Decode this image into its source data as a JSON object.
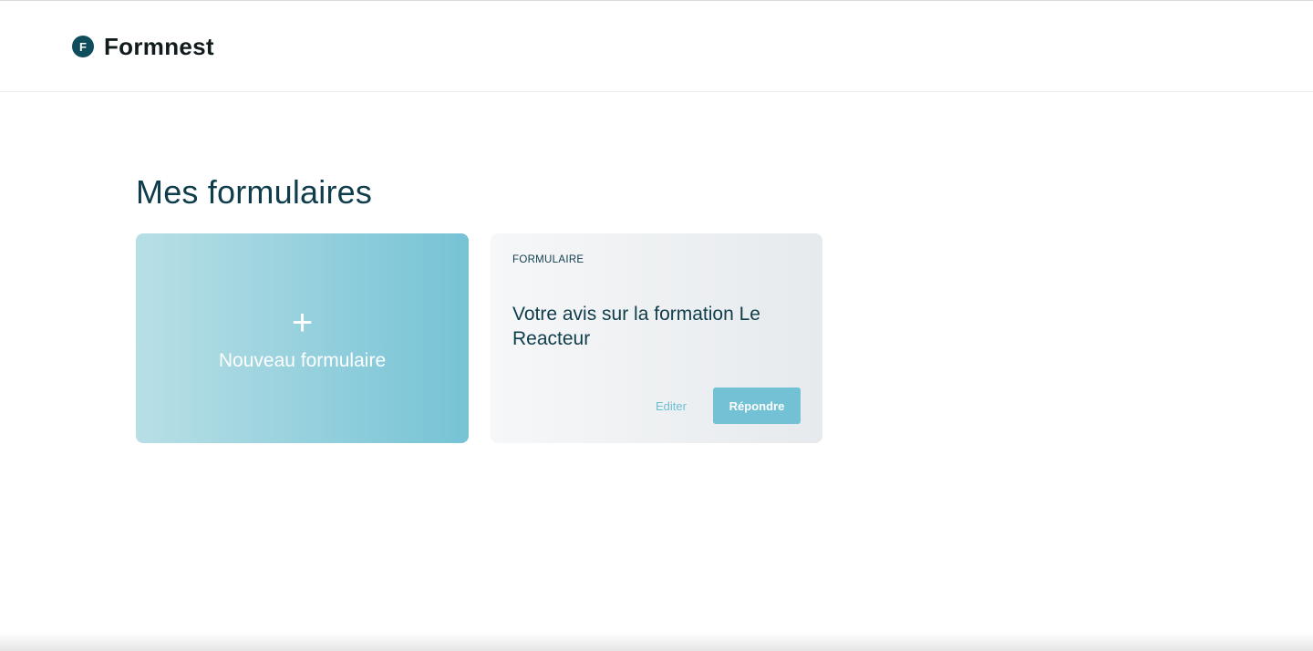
{
  "app": {
    "brand_initial": "F",
    "brand_name": "Formnest"
  },
  "main": {
    "page_title": "Mes formulaires",
    "new_card": {
      "plus_symbol": "+",
      "label": "Nouveau formulaire"
    },
    "forms": [
      {
        "kind": "FORMULAIRE",
        "title": "Votre avis sur la formation Le Reacteur",
        "edit_label": "Editer",
        "answer_label": "Répondre"
      }
    ]
  },
  "colors": {
    "brand_dark": "#0f4c5c",
    "title_text": "#0f3d4c",
    "accent": "#72c1d4",
    "new_card_gradient_start": "#b8dfe6",
    "new_card_gradient_end": "#76c3d5",
    "form_card_gradient_start": "#f6f7f8",
    "form_card_gradient_end": "#e6eaed"
  },
  "icons": {
    "brand_logo": "brand-logo-icon",
    "plus": "plus-icon"
  }
}
